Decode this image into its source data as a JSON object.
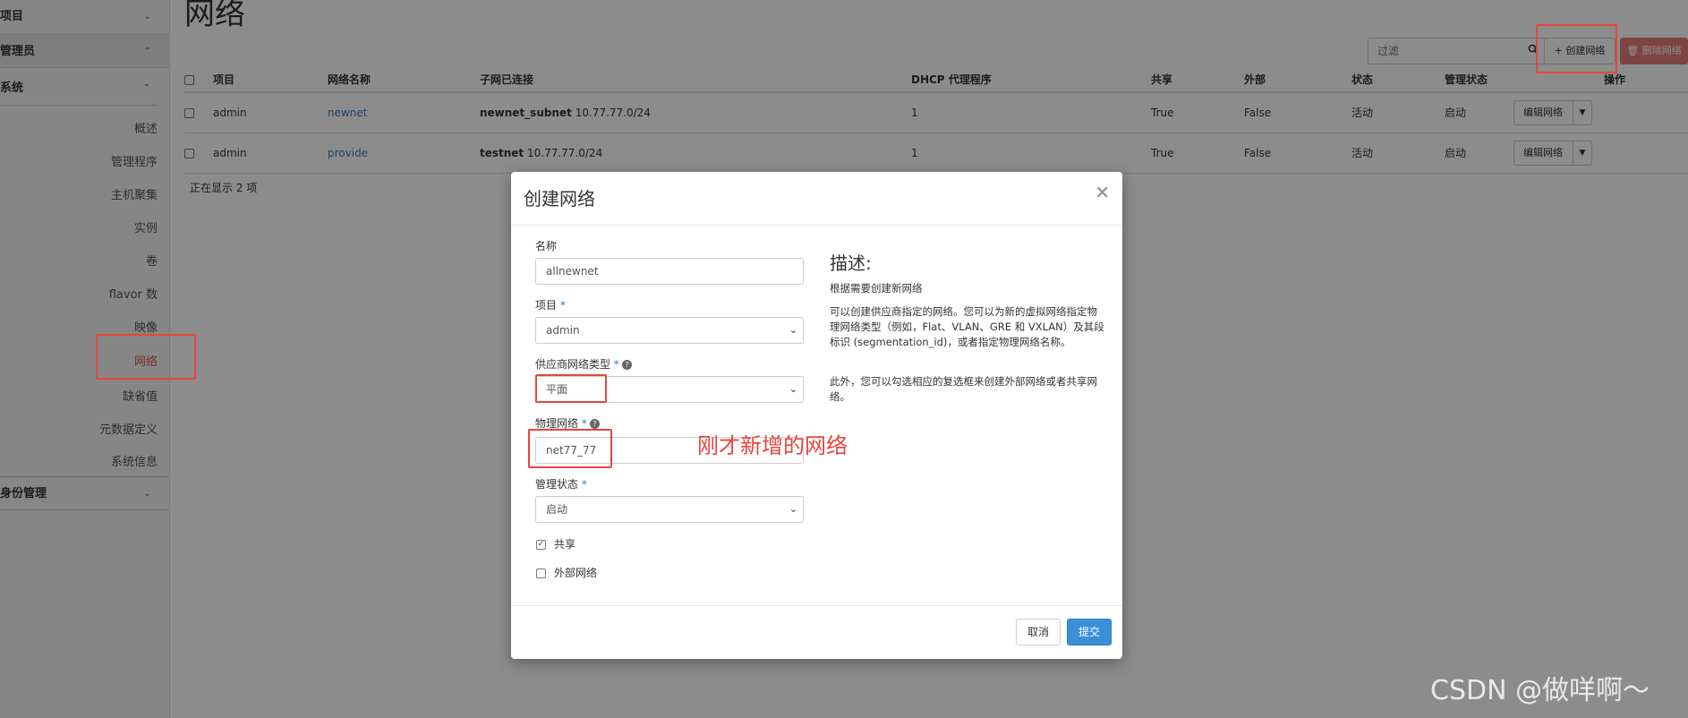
{
  "sidebar": {
    "sections": {
      "project": "项目",
      "admin": "管理员",
      "system": "系统",
      "identity": "身份管理"
    },
    "items": [
      "概述",
      "管理程序",
      "主机聚集",
      "实例",
      "卷",
      "flavor 数",
      "映像",
      "网络",
      "缺省值",
      "元数据定义",
      "系统信息"
    ],
    "active_item": "网络"
  },
  "page": {
    "title": "网络",
    "filter_placeholder": "过滤",
    "create_button": "创建网络",
    "delete_button": "删除网络",
    "showing": "正在显示 2 项"
  },
  "table": {
    "headers": [
      "项目",
      "网络名称",
      "子网已连接",
      "DHCP 代理程序",
      "共享",
      "外部",
      "状态",
      "管理状态",
      "操作"
    ],
    "rows": [
      {
        "project": "admin",
        "name": "newnet",
        "subnet_name": "newnet_subnet",
        "subnet_cidr": "10.77.77.0/24",
        "dhcp": "1",
        "shared": "True",
        "external": "False",
        "status": "活动",
        "admin_state": "启动",
        "action": "编辑网络"
      },
      {
        "project": "admin",
        "name": "provide",
        "subnet_name": "testnet",
        "subnet_cidr": "10.77.77.0/24",
        "dhcp": "1",
        "shared": "True",
        "external": "False",
        "status": "活动",
        "admin_state": "启动",
        "action": "编辑网络"
      }
    ]
  },
  "modal": {
    "title": "创建网络",
    "close": "×",
    "fields": {
      "name_label": "名称",
      "name_value": "allnewnet",
      "project_label": "项目",
      "project_value": "admin",
      "provider_type_label": "供应商网络类型",
      "provider_type_value": "平面",
      "physical_network_label": "物理网络",
      "physical_network_value": "net77_77",
      "admin_state_label": "管理状态",
      "admin_state_value": "启动",
      "shared_label": "共享",
      "shared_checked": true,
      "external_label": "外部网络",
      "external_checked": false
    },
    "description": {
      "title": "描述:",
      "p1": "根据需要创建新网络",
      "p2": "可以创建供应商指定的网络。您可以为新的虚拟网络指定物理网络类型（例如，Flat、VLAN、GRE 和 VXLAN）及其段标识 (segmentation_id)，或者指定物理网络名称。",
      "p3": "此外，您可以勾选相应的复选框来创建外部网络或者共享网络。"
    },
    "cancel": "取消",
    "submit": "提交"
  },
  "annotation": {
    "text": "刚才新增的网络"
  },
  "watermark": "CSDN @做咩啊～",
  "colors": {
    "accent": "#3a79b7",
    "danger": "#d9534f",
    "annotation": "#e8453c",
    "primary_button": "#3a8fd9"
  }
}
